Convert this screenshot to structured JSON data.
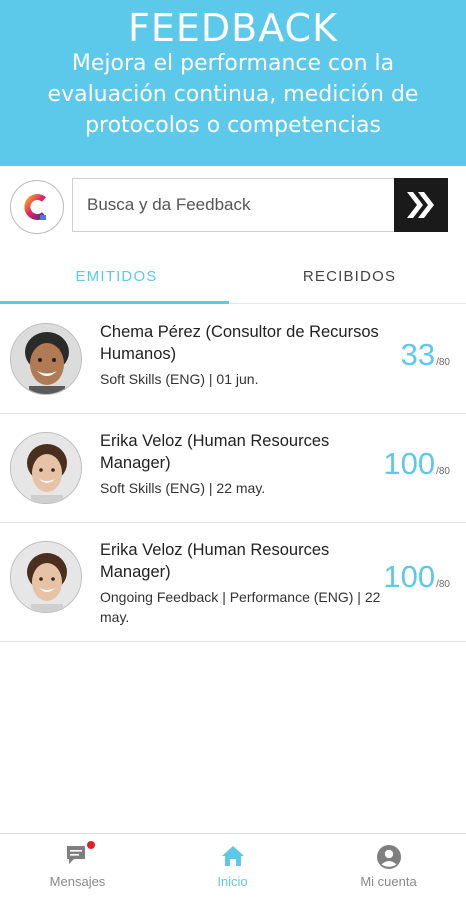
{
  "header": {
    "title": "FEEDBACK",
    "subtitle": "Mejora el performance con la evaluación continua, medición de protocolos o competencias"
  },
  "search": {
    "placeholder": "Busca y da Feedback",
    "logo_icon": "c-logo-icon",
    "go_icon": "double-chevron-right-icon"
  },
  "tabs": [
    {
      "label": "EMITIDOS",
      "active": true
    },
    {
      "label": "RECIBIDOS",
      "active": false
    }
  ],
  "feedback_items": [
    {
      "name": "Chema Pérez (Consultor de Recursos Humanos)",
      "meta": "Soft Skills  (ENG) | 01 jun.",
      "score": "33",
      "max": "/80"
    },
    {
      "name": "Erika Veloz (Human Resources Manager)",
      "meta": "Soft Skills  (ENG) | 22 may.",
      "score": "100",
      "max": "/80"
    },
    {
      "name": "Erika Veloz (Human Resources Manager)",
      "meta": "Ongoing Feedback | Performance (ENG) | 22 may.",
      "score": "100",
      "max": "/80"
    }
  ],
  "nav": [
    {
      "label": "Mensajes",
      "icon": "chat-icon",
      "has_badge": true
    },
    {
      "label": "Inicio",
      "icon": "home-icon",
      "active": true
    },
    {
      "label": "Mi cuenta",
      "icon": "account-icon"
    }
  ],
  "colors": {
    "accent": "#5cc8ea",
    "badge": "#d9232d",
    "dark": "#1a1a1a"
  }
}
